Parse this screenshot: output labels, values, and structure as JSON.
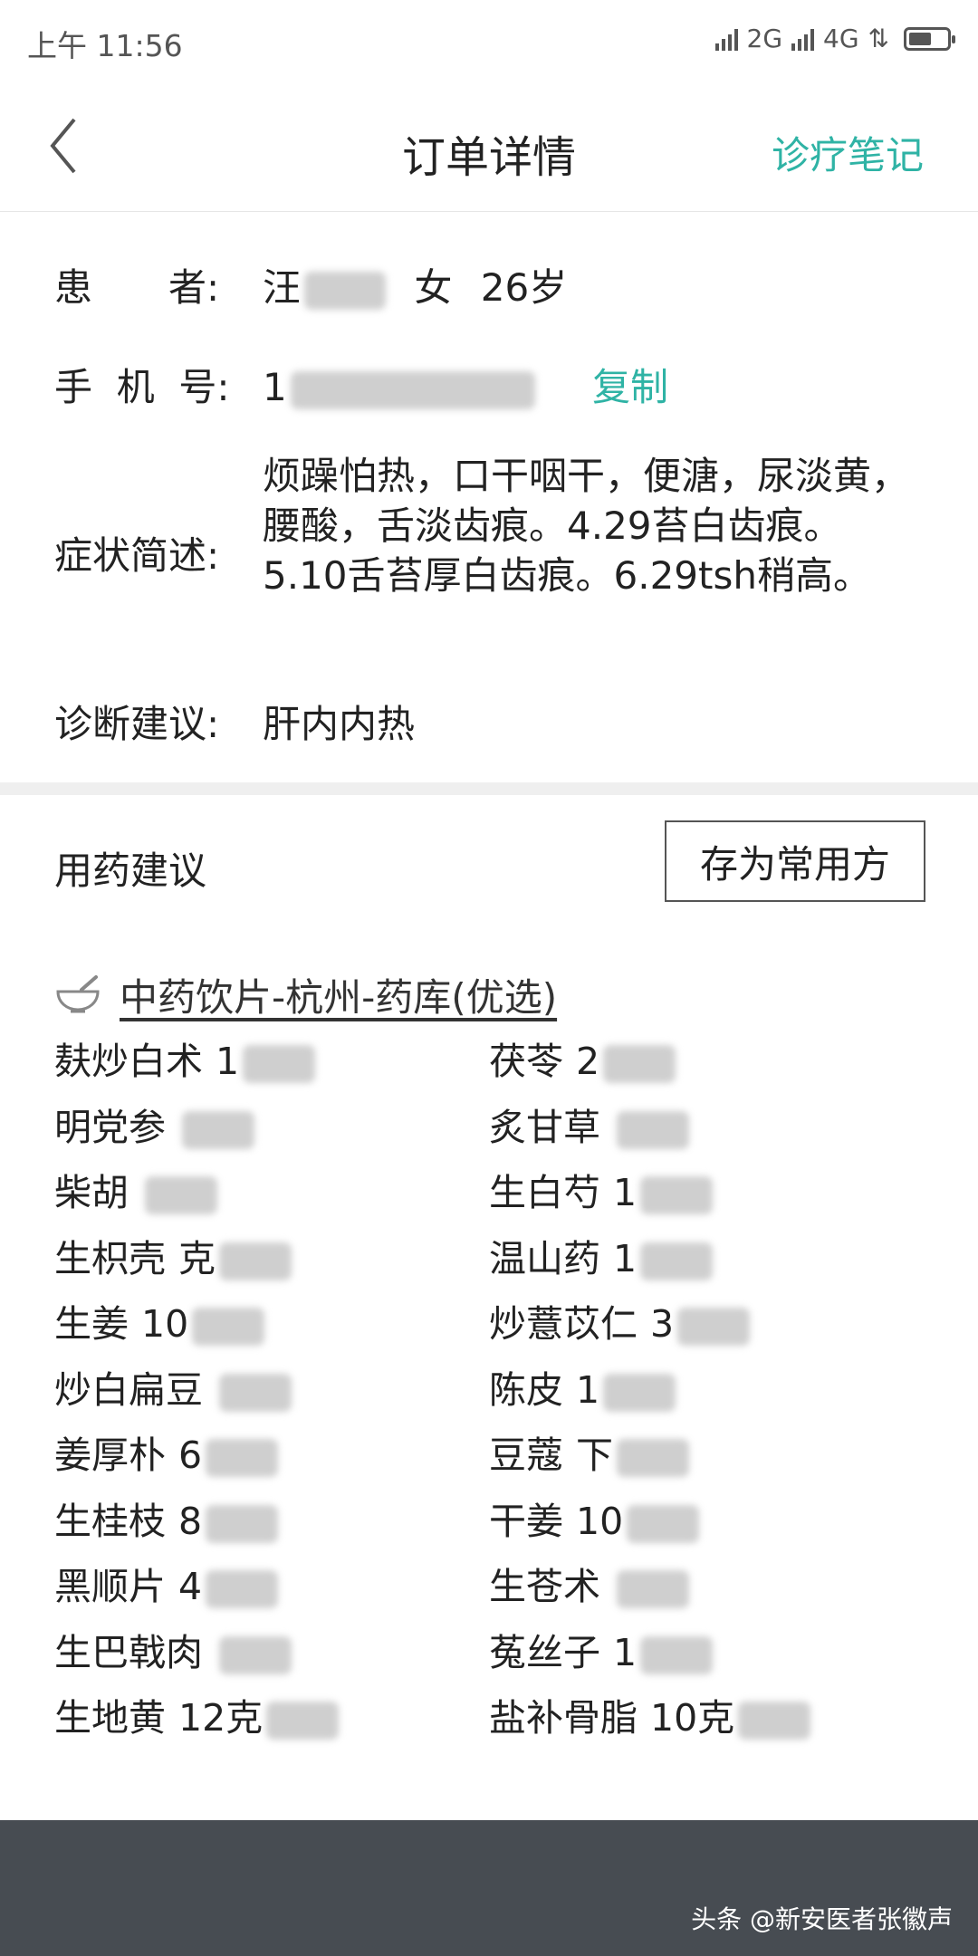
{
  "status_bar": {
    "time": "上午 11:56",
    "network_1": "2G",
    "network_2": "4G",
    "battery_level": 0.6
  },
  "header": {
    "title": "订单详情",
    "action_label": "诊疗笔记"
  },
  "patient": {
    "name_label": "患　　者:",
    "name_visible": "汪",
    "gender": "女",
    "age": "26岁",
    "phone_label": "手  机  号:",
    "phone_visible": "1",
    "copy_label": "复制",
    "symptom_label": "症状简述:",
    "symptom_text": "烦躁怕热，口干咽干，便溏，尿淡黄，腰酸，舌淡齿痕。4.29苔白齿痕。5.10舌苔厚白齿痕。6.29tsh稍高。",
    "diagnosis_label": "诊断建议:",
    "diagnosis_text": "肝内内热"
  },
  "medication": {
    "title": "用药建议",
    "save_button_label": "存为常用方",
    "pharmacy_label": "中药饮片-杭州-药库(优选)",
    "herbs_left": [
      {
        "name": "麸炒白术",
        "amount": "1"
      },
      {
        "name": "明党参",
        "amount": ""
      },
      {
        "name": "柴胡",
        "amount": ""
      },
      {
        "name": "生枳壳",
        "amount": "克"
      },
      {
        "name": "生姜",
        "amount": "10"
      },
      {
        "name": "炒白扁豆",
        "amount": ""
      },
      {
        "name": "姜厚朴",
        "amount": "6"
      },
      {
        "name": "生桂枝",
        "amount": "8"
      },
      {
        "name": "黑顺片",
        "amount": "4"
      },
      {
        "name": "生巴戟肉",
        "amount": ""
      },
      {
        "name": "生地黄",
        "amount": "12克"
      }
    ],
    "herbs_right": [
      {
        "name": "茯苓",
        "amount": "2"
      },
      {
        "name": "炙甘草",
        "amount": ""
      },
      {
        "name": "生白芍",
        "amount": "1"
      },
      {
        "name": "温山药",
        "amount": "1"
      },
      {
        "name": "炒薏苡仁",
        "amount": "3"
      },
      {
        "name": "陈皮",
        "amount": "1"
      },
      {
        "name": "豆蔻",
        "amount": "下"
      },
      {
        "name": "干姜",
        "amount": "10"
      },
      {
        "name": "生苍术",
        "amount": ""
      },
      {
        "name": "菟丝子",
        "amount": "1"
      },
      {
        "name": "盐补骨脂",
        "amount": "10克"
      }
    ]
  },
  "footer": {
    "watermark": "头条 @新安医者张徽声"
  },
  "colors": {
    "accent": "#2fb3a5",
    "footer_bg": "#474c52"
  }
}
